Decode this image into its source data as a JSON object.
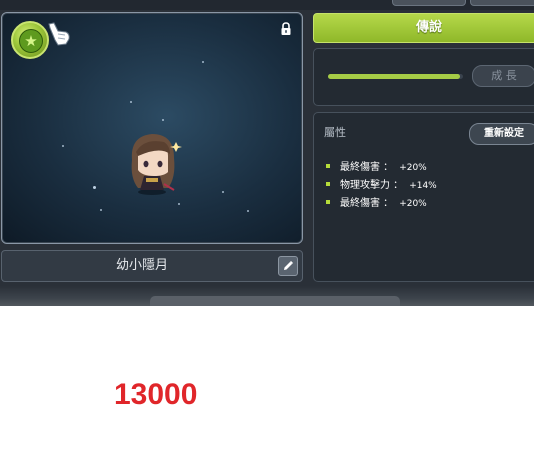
{
  "pet": {
    "name": "幼小隱月",
    "grade": "傳說",
    "growth_progress": 0.98
  },
  "buttons": {
    "growth": "成 長",
    "reset": "重新設定"
  },
  "attributes": {
    "title": "屬性",
    "items": [
      {
        "name": "最終傷害 ：",
        "value": "+20%"
      },
      {
        "name": "物理攻擊力 ：",
        "value": "+14%"
      },
      {
        "name": "最終傷害 ：",
        "value": "+20%"
      }
    ]
  },
  "icons": {
    "grade_badge": "green-star-badge-icon",
    "cursor": "pointing-hand-cursor-icon",
    "lock": "lock-icon",
    "edit": "pencil-icon"
  },
  "colors": {
    "grade_green": "#9cc63a",
    "bullet_green": "#b6dc3a",
    "result_red": "#e0262a"
  },
  "result": {
    "value": "13000"
  }
}
